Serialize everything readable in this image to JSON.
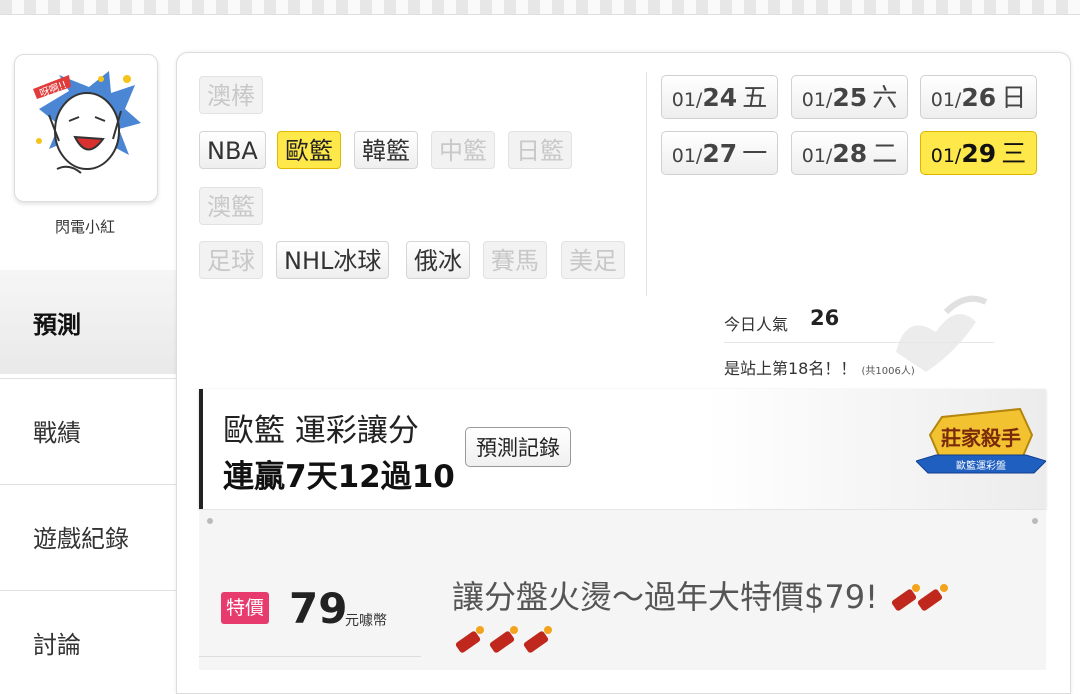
{
  "user": {
    "name": "閃電小紅"
  },
  "side_menu": [
    {
      "label": "預測",
      "active": true
    },
    {
      "label": "戰績",
      "active": false
    },
    {
      "label": "遊戲紀錄",
      "active": false
    },
    {
      "label": "討論",
      "active": false
    }
  ],
  "sports": [
    {
      "label": "澳棒",
      "state": "disabled"
    },
    {
      "label": "NBA",
      "state": "normal"
    },
    {
      "label": "歐籃",
      "state": "selected"
    },
    {
      "label": "韓籃",
      "state": "normal"
    },
    {
      "label": "中籃",
      "state": "disabled"
    },
    {
      "label": "日籃",
      "state": "disabled"
    },
    {
      "label": "澳籃",
      "state": "disabled"
    },
    {
      "label": "足球",
      "state": "disabled"
    },
    {
      "label": "NHL冰球",
      "state": "normal"
    },
    {
      "label": "俄冰",
      "state": "normal"
    },
    {
      "label": "賽馬",
      "state": "disabled"
    },
    {
      "label": "美足",
      "state": "disabled"
    }
  ],
  "dates": [
    {
      "md": "01/",
      "day": "24",
      "weekday": "五",
      "selected": false
    },
    {
      "md": "01/",
      "day": "25",
      "weekday": "六",
      "selected": false
    },
    {
      "md": "01/",
      "day": "26",
      "weekday": "日",
      "selected": false
    },
    {
      "md": "01/",
      "day": "27",
      "weekday": "一",
      "selected": false
    },
    {
      "md": "01/",
      "day": "28",
      "weekday": "二",
      "selected": false
    },
    {
      "md": "01/",
      "day": "29",
      "weekday": "三",
      "selected": true
    }
  ],
  "popularity": {
    "label": "今日人氣",
    "value": "26",
    "rank_text": "是站上第18名！！",
    "rank_total": "(共1006人)"
  },
  "banner": {
    "title": "歐籃 運彩讓分",
    "subtitle": "連贏7天12過10",
    "record_button": "預測記錄",
    "badge_main": "莊家殺手",
    "badge_sub": "歐籃運彩盤"
  },
  "offer": {
    "tag": "特價",
    "price": "79",
    "unit": "元噱幣",
    "title": "讓分盤火燙～過年大特價$79!"
  },
  "colors": {
    "selected_yellow": "#ffe84a",
    "special_pink": "#e73b6e",
    "badge_gold": "#f2c230",
    "badge_blue": "#1f5fbf"
  }
}
